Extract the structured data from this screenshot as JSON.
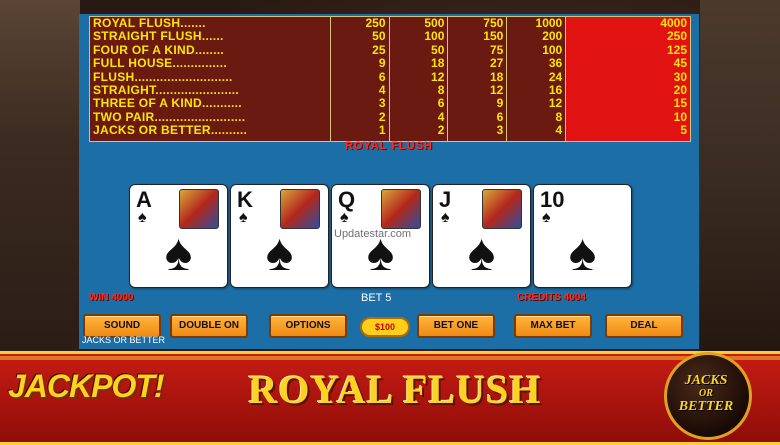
{
  "paytable": {
    "hands": [
      "ROYAL FLUSH.......",
      "STRAIGHT FLUSH......",
      "FOUR OF A KIND........",
      "FULL HOUSE...............",
      "FLUSH...........................",
      "STRAIGHT.......................",
      "THREE OF A KIND...........",
      "TWO PAIR.........................",
      "JACKS OR BETTER.........."
    ],
    "coin1": [
      "250",
      "50",
      "25",
      "9",
      "6",
      "4",
      "3",
      "2",
      "1"
    ],
    "coin2": [
      "500",
      "100",
      "50",
      "18",
      "12",
      "8",
      "6",
      "4",
      "2"
    ],
    "coin3": [
      "750",
      "150",
      "75",
      "27",
      "18",
      "12",
      "9",
      "6",
      "3"
    ],
    "coin4": [
      "1000",
      "200",
      "100",
      "36",
      "24",
      "16",
      "12",
      "8",
      "4"
    ],
    "coin5": [
      "4000",
      "250",
      "125",
      "45",
      "30",
      "20",
      "15",
      "10",
      "5"
    ]
  },
  "result": "ROYAL FLUSH",
  "cards": [
    {
      "rank": "A",
      "suit": "♠"
    },
    {
      "rank": "K",
      "suit": "♠"
    },
    {
      "rank": "Q",
      "suit": "♠"
    },
    {
      "rank": "J",
      "suit": "♠"
    },
    {
      "rank": "10",
      "suit": "♠"
    }
  ],
  "watermark": "Updatestar.com",
  "status": {
    "win": "WIN 4000",
    "bet": "BET 5",
    "credits": "CREDITS 4004"
  },
  "buttons": {
    "sound": "SOUND",
    "double": "DOUBLE ON",
    "options": "OPTIONS",
    "chip": "$100",
    "bet_one": "BET ONE",
    "max_bet": "MAX BET",
    "deal": "DEAL"
  },
  "game_name": "JACKS OR BETTER",
  "banner": {
    "jackpot": "JACKPOT!",
    "title": "ROYAL FLUSH",
    "logo_line1": "JACKS",
    "logo_line2": "OR",
    "logo_line3": "BETTER"
  },
  "colors": {
    "table_bg": "#1c6ea6",
    "paytable_bg": "#6b1a12",
    "paytable_highlight": "#e01212",
    "paytable_text": "#ffe600",
    "button": "#f08a14",
    "banner": "#c61c14"
  }
}
